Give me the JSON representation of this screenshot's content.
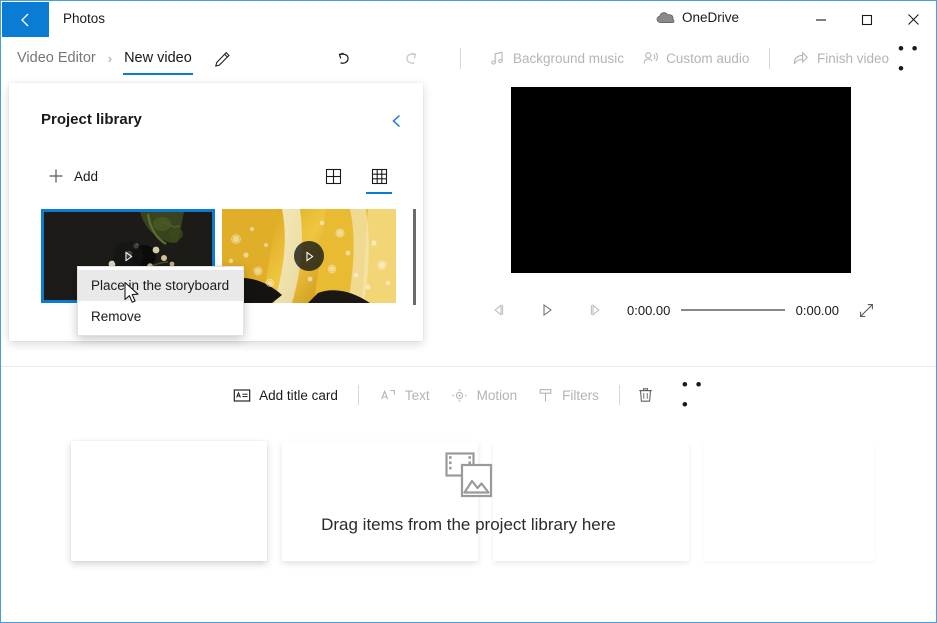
{
  "titlebar": {
    "back_icon": "back-arrow-icon",
    "app_title": "Photos",
    "onedrive_label": "OneDrive",
    "onedrive_icon": "onedrive-cloud-icon",
    "minimize_icon": "minimize-icon",
    "maximize_icon": "maximize-icon",
    "close_icon": "close-icon"
  },
  "commandbar": {
    "breadcrumb_root": "Video Editor",
    "breadcrumb_sep": "›",
    "breadcrumb_current": "New video",
    "rename_icon": "pencil-icon",
    "undo_icon": "undo-icon",
    "redo_icon": "redo-icon",
    "background_music": "Background music",
    "custom_audio": "Custom audio",
    "finish_video": "Finish video",
    "more_label": "• • •"
  },
  "library": {
    "title": "Project library",
    "collapse_icon": "chevron-left-icon",
    "add_label": "Add",
    "add_icon": "plus-icon",
    "view_large_icon": "grid-large-icon",
    "view_small_icon": "grid-small-icon",
    "view_selected": "small",
    "items": [
      {
        "name": "video-thumbnail-flowers",
        "selected": true,
        "play_icon": "play-icon"
      },
      {
        "name": "video-thumbnail-lemon",
        "selected": false,
        "play_icon": "play-icon"
      }
    ]
  },
  "context_menu": {
    "items": [
      {
        "label": "Place in the storyboard",
        "hovered": true
      },
      {
        "label": "Remove",
        "hovered": false
      }
    ]
  },
  "preview": {
    "prev_frame_icon": "previous-frame-icon",
    "play_icon": "play-icon",
    "next_frame_icon": "next-frame-icon",
    "current_time": "0:00.00",
    "total_time": "0:00.00",
    "expand_icon": "fullscreen-icon"
  },
  "storyboard": {
    "add_title_card": "Add title card",
    "add_title_card_icon": "title-card-icon",
    "text_label": "Text",
    "text_icon": "text-icon",
    "motion_label": "Motion",
    "motion_icon": "motion-icon",
    "filters_label": "Filters",
    "filters_icon": "filters-icon",
    "delete_icon": "trash-icon",
    "more_label": "• • •",
    "dropzone_text": "Drag items from the project library here",
    "dropzone_icon": "media-placeholder-icon"
  },
  "colors": {
    "accent": "#0a7cd4",
    "disabled_text": "#b4b4b4",
    "text": "#1a1a1a",
    "window_border": "#4a9fe0"
  }
}
